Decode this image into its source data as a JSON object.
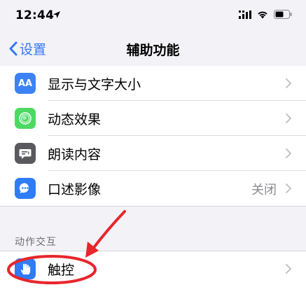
{
  "status_bar": {
    "time": "12:44"
  },
  "nav": {
    "back_label": "设置",
    "title": "辅助功能"
  },
  "rows": [
    {
      "label": "显示与文字大小",
      "icon": "aa-text-icon",
      "icon_text": "AA",
      "color": "#3c82f6",
      "value": ""
    },
    {
      "label": "动态效果",
      "icon": "motion-icon",
      "color": "#4cd964",
      "value": ""
    },
    {
      "label": "朗读内容",
      "icon": "speech-bubble-icon",
      "color": "#5a5a5e",
      "value": ""
    },
    {
      "label": "口述影像",
      "icon": "audio-description-icon",
      "color": "#2f7cf6",
      "value": "关闭"
    }
  ],
  "section": {
    "header": "动作交互"
  },
  "touch_row": {
    "label": "触控",
    "icon": "hand-touch-icon",
    "color": "#2f7cf6"
  },
  "colors": {
    "accent": "#3478f6",
    "annotation": "#e8262b"
  }
}
